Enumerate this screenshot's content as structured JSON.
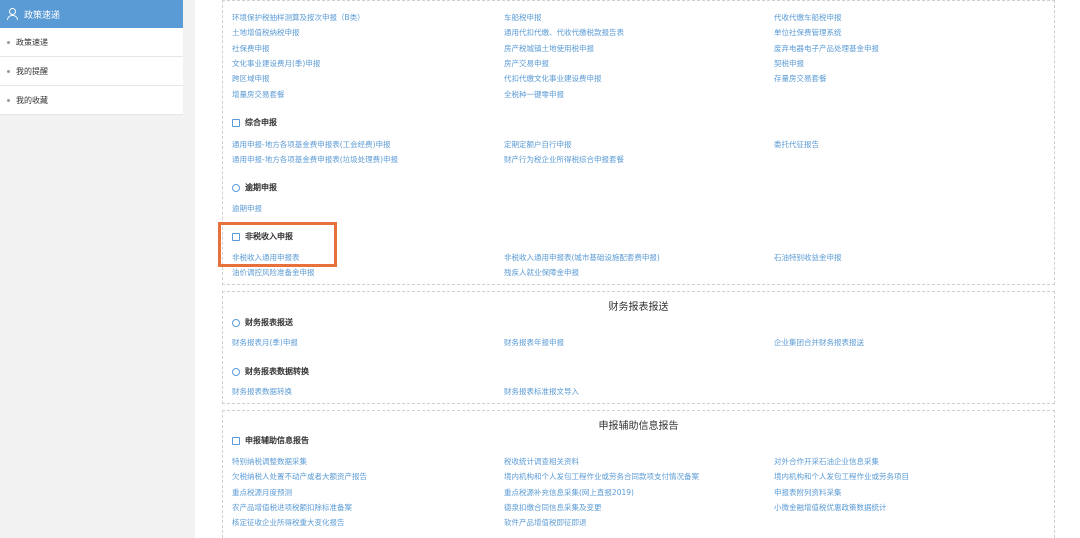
{
  "sidebar": {
    "header": "政策速递",
    "items": [
      {
        "label": "政策速递"
      },
      {
        "label": "我的提醒"
      },
      {
        "label": "我的收藏"
      }
    ]
  },
  "panel1": {
    "links": [
      [
        "环境保护税抽样测算及按次申报（B类）",
        "车船税申报",
        "代收代缴车船税申报"
      ],
      [
        "土地增值税纳税申报",
        "通用代扣代缴、代收代缴税款报告表",
        "单位社保费管理系统"
      ],
      [
        "社保费申报",
        "房产税城镇土地使用税申报",
        "废弃电器电子产品处理基金申报"
      ],
      [
        "文化事业建设费月(季)申报",
        "房产交易申报",
        "契税申报"
      ],
      [
        "跨区域申报",
        "代扣代缴文化事业建设费申报",
        "存量房交易套餐"
      ],
      [
        "增量房交易套餐",
        "全税种一键零申报",
        ""
      ]
    ],
    "sec_comprehensive": "综合申报",
    "comprehensive": [
      [
        "通用申报-地方各项基金费申报表(工会经费)申报",
        "定期定额户自行申报",
        "委托代征报告"
      ],
      [
        "通用申报-地方各项基金费申报表(垃圾处理费)申报",
        "财产行为税企业所得税综合申报套餐",
        ""
      ]
    ],
    "sec_overdue": "逾期申报",
    "overdue": [
      "逾期申报"
    ],
    "sec_nontax": "非税收入申报",
    "nontax": [
      [
        "非税收入通用申报表",
        "非税收入通用申报表(城市基础设施配套费申报)",
        "石油特别收益金申报"
      ],
      [
        "油价调控风险准备金申报",
        "残疾人就业保障金申报",
        ""
      ]
    ]
  },
  "panel2": {
    "title": "财务报表报送",
    "sec_submit": "财务报表报送",
    "submit": [
      "财务报表月(季)申报",
      "财务报表年报申报",
      "企业集团合并财务报表报送"
    ],
    "sec_convert": "财务报表数据转换",
    "convert": [
      "财务报表数据转换",
      "财务报表标准报文导入"
    ]
  },
  "panel3": {
    "title": "申报辅助信息报告",
    "sec_aux": "申报辅助信息报告",
    "aux": [
      [
        "特别纳税调整数据采集",
        "税收统计调查相关资料",
        "对外合作开采石油企业信息采集"
      ],
      [
        "欠税纳税人处置不动产或者大额资产报告",
        "境内机构和个人发包工程作业或劳务合同款项支付情况备案",
        "境内机构和个人发包工程作业或劳务项目"
      ],
      [
        "重点税源月度预测",
        "重点税源补充信息采集(网上直报2019)",
        "申报表附列资料采集"
      ],
      [
        "农产品增值税进项税额扣除标准备案",
        "德泉扣缴合同信息采集及变更",
        "小微金融增值税优惠政策数据统计"
      ],
      [
        "核定征收企业所得税重大变化报告",
        "软件产品增值税即征即退",
        ""
      ]
    ]
  }
}
